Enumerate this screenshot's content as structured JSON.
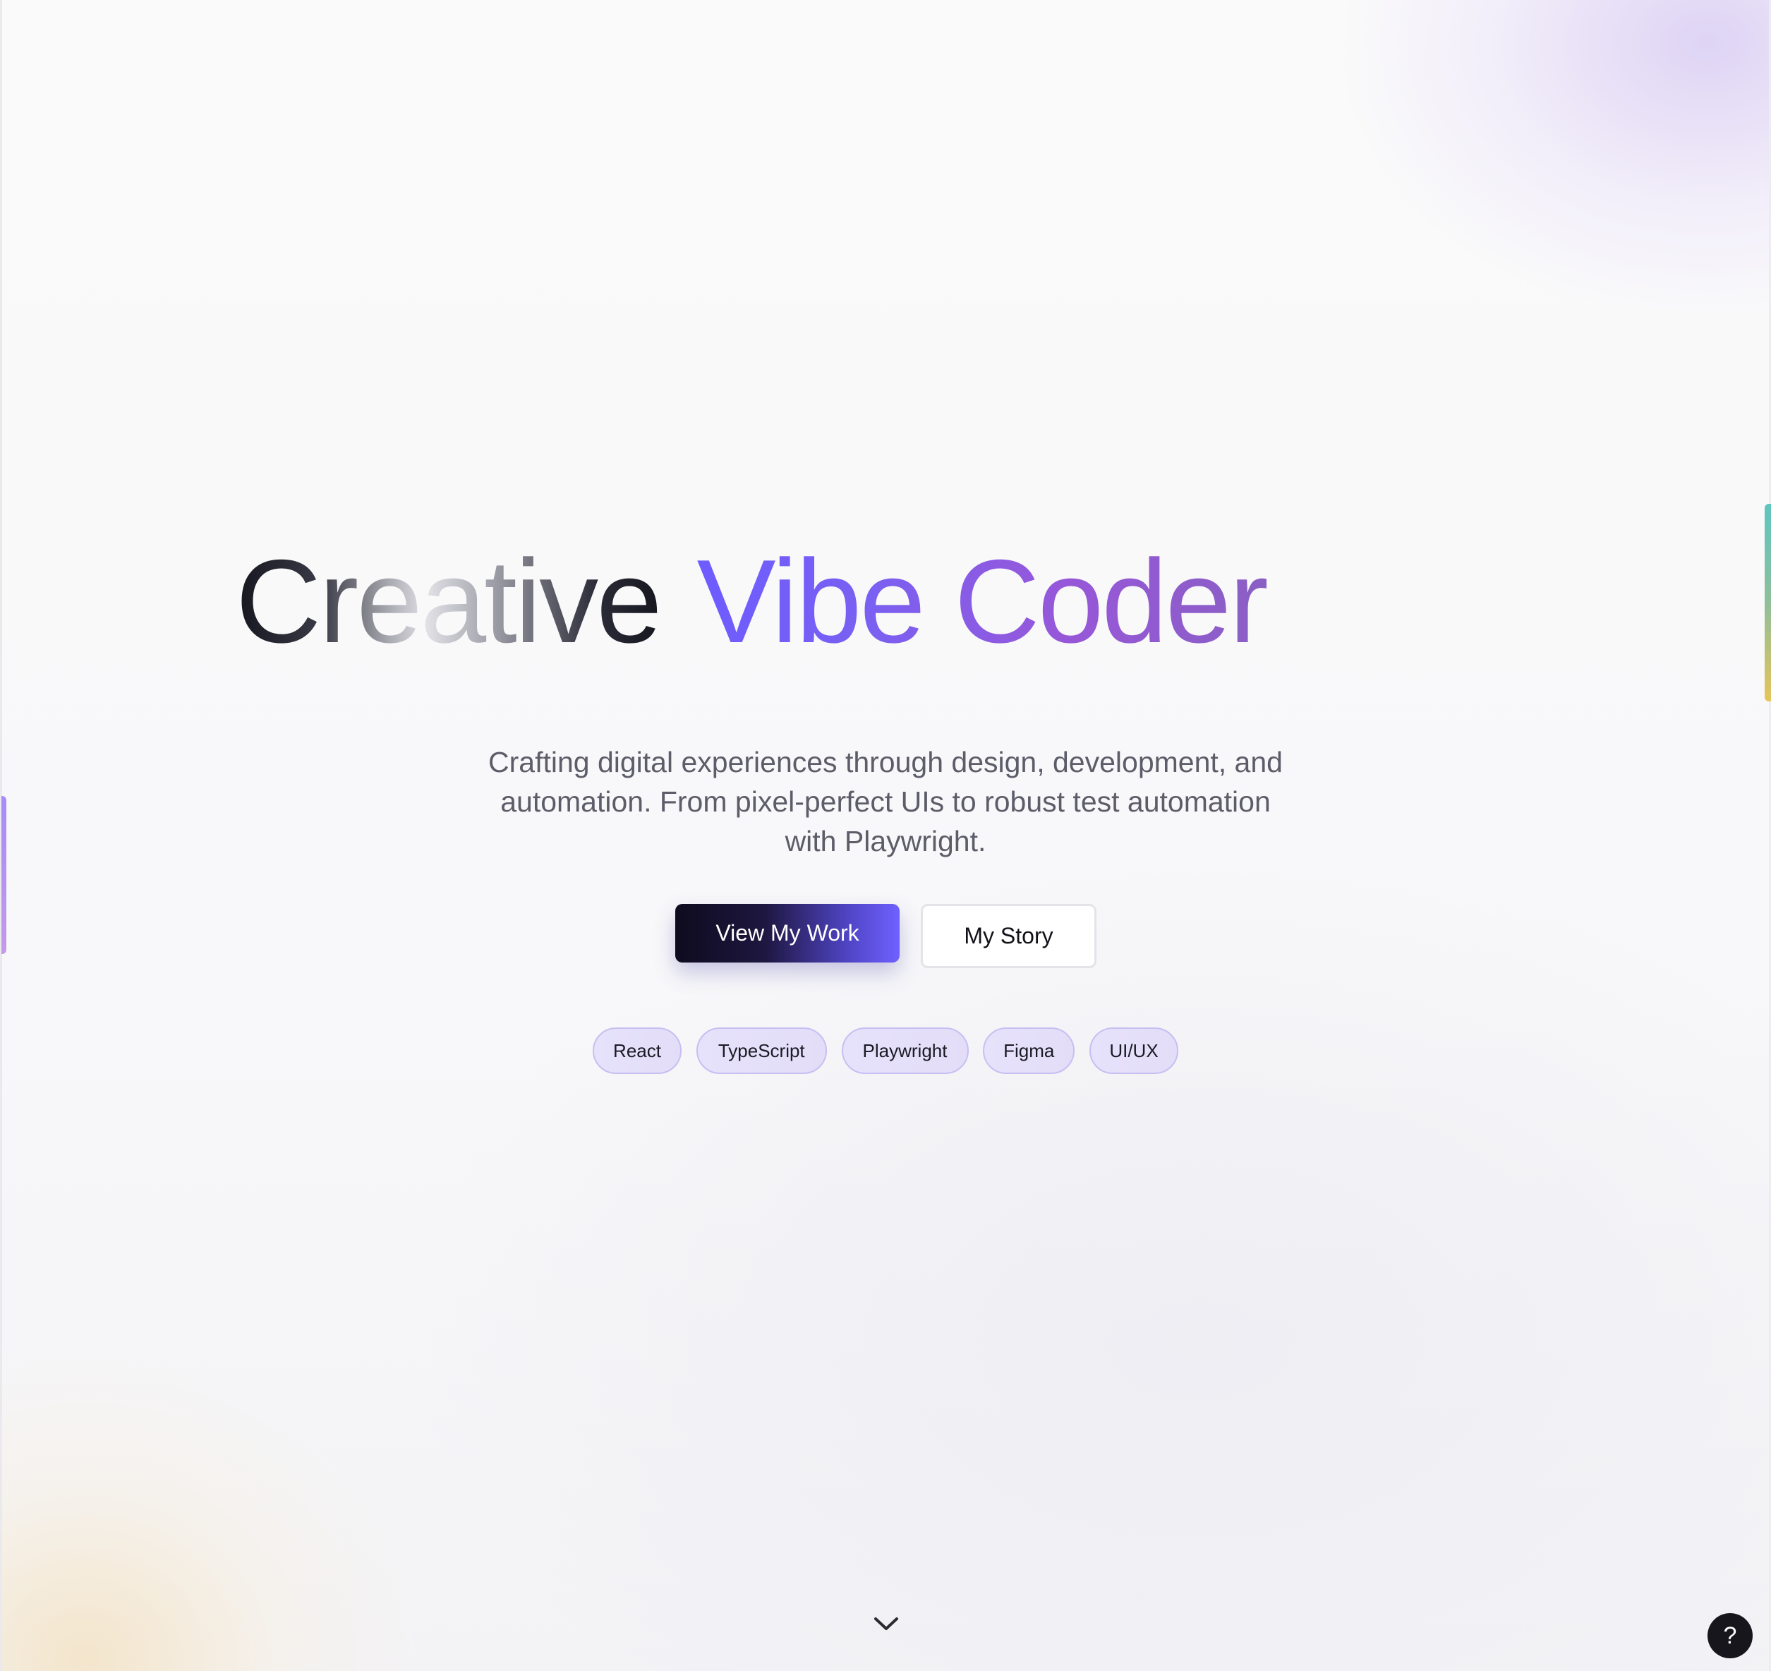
{
  "hero": {
    "title_part1": "Creative",
    "title_part2": "Vibe Coder",
    "subtitle_line1": "Crafting digital experiences through design, development, and",
    "subtitle_line2": "automation. From pixel-perfect UIs to robust test automation",
    "subtitle_line3": "with Playwright."
  },
  "buttons": {
    "primary_label": "View My Work",
    "secondary_label": "My Story"
  },
  "tags": [
    "React",
    "TypeScript",
    "Playwright",
    "Figma",
    "UI/UX"
  ],
  "icons": {
    "scroll": "chevron-down-icon",
    "help": "?"
  },
  "colors": {
    "accent": "#6d5cff",
    "accent_purple": "#9757d8",
    "primary_button_dark": "#0e0b1e",
    "tag_border": "#c7bff2",
    "help_button": "#16161c"
  }
}
